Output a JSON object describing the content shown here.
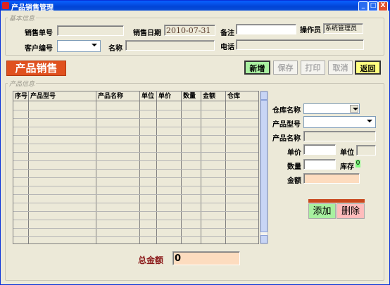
{
  "window": {
    "title": "产品销售管理",
    "minimize": "_",
    "maximize": "□",
    "close": "X"
  },
  "basic_info": {
    "legend": "基本信息",
    "sale_no_label": "销售单号",
    "sale_no_value": "",
    "sale_date_label": "销售日期",
    "sale_date_value": "2010-07-31",
    "remark_label": "备注",
    "remark_value": "",
    "operator_label": "操作员",
    "operator_value": "系统管理员",
    "customer_no_label": "客户编号",
    "customer_no_value": "",
    "name_label": "名称",
    "name_value": "",
    "phone_label": "电话",
    "phone_value": ""
  },
  "banner": "产品销售",
  "toolbar": {
    "new": "新增",
    "save": "保存",
    "print": "打印",
    "cancel": "取消",
    "back": "返回"
  },
  "product_info": {
    "legend": "产品信息",
    "columns": [
      "序号",
      "产品型号",
      "产品名称",
      "单位",
      "单价",
      "数量",
      "金额",
      "仓库"
    ],
    "row_count": 17
  },
  "detail": {
    "warehouse_label": "仓库名称",
    "model_label": "产品型号",
    "product_name_label": "产品名称",
    "unit_price_label": "单价",
    "unit_label": "单位",
    "quantity_label": "数量",
    "stock_label": "库存",
    "stock_value": "0",
    "amount_label": "金额"
  },
  "actions": {
    "add": "添加",
    "delete": "删除"
  },
  "total": {
    "label": "总金额",
    "value": "0"
  },
  "colors": {
    "title_bar": "#0a5cf0",
    "banner": "#e0511f",
    "new_btn": "#a9f0a0",
    "back_btn": "#ffff80",
    "add_btn": "#a8f0a0",
    "delete_btn": "#ffbcbc",
    "total_box": "#fddcbf",
    "stock_box": "#7fff7f"
  }
}
